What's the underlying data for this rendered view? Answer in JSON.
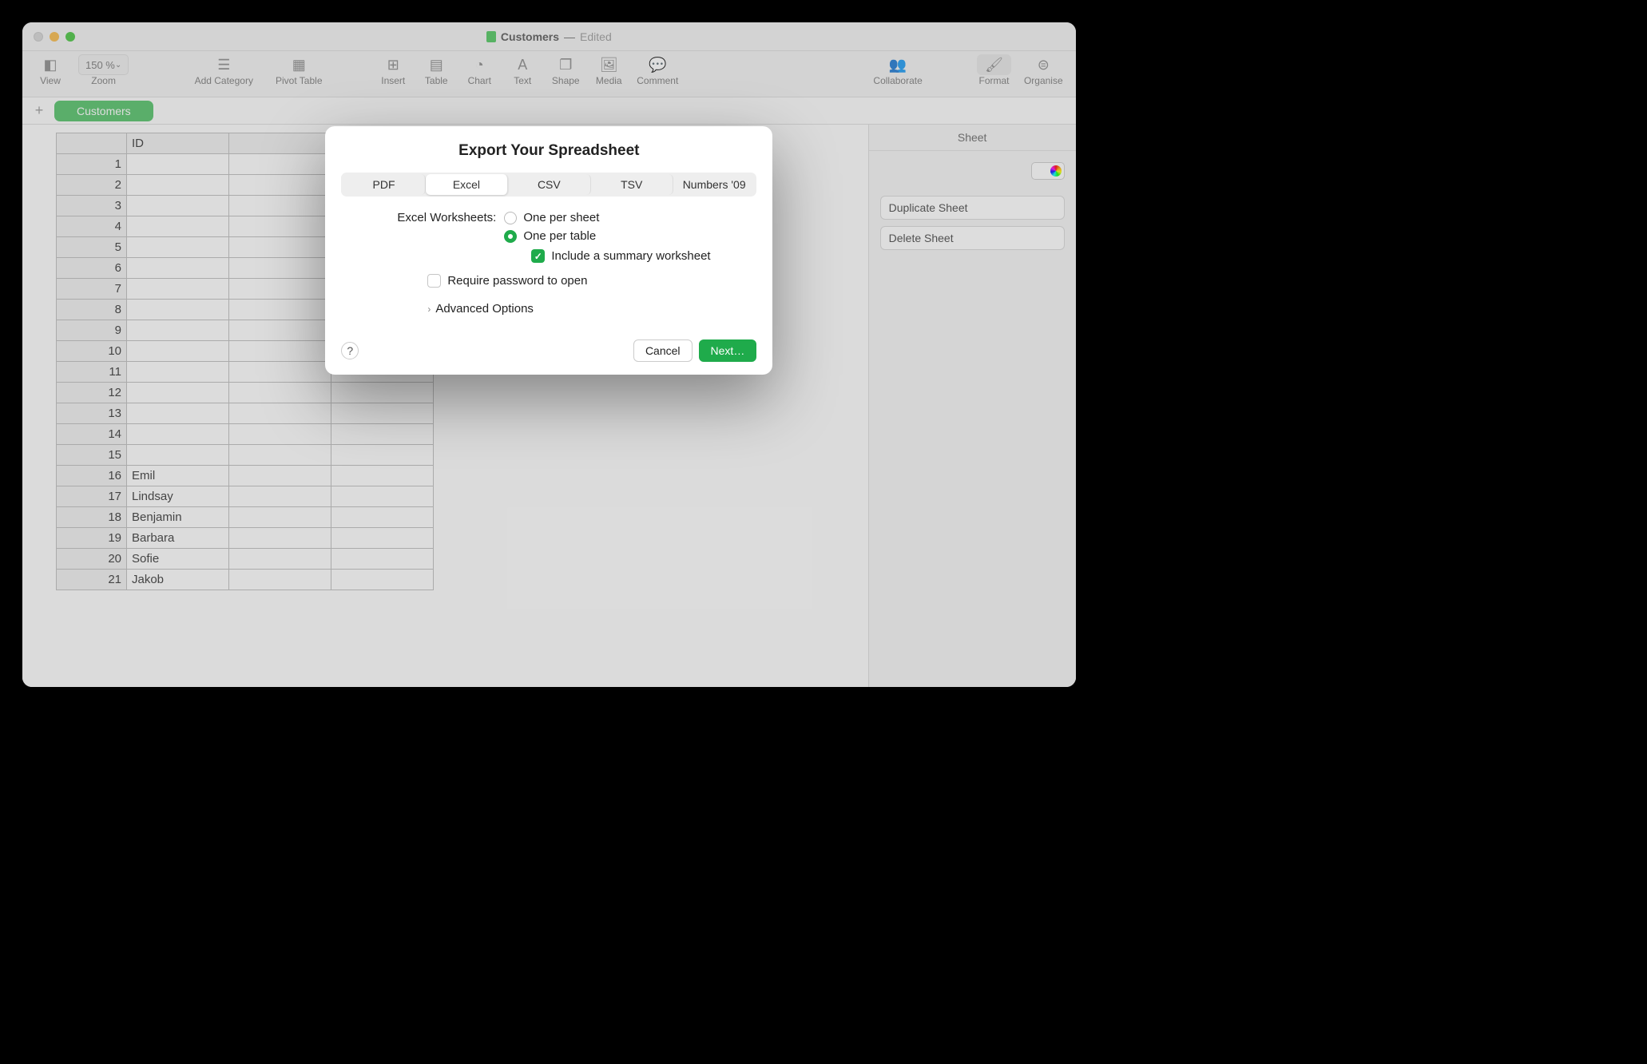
{
  "titlebar": {
    "doc_name": "Customers",
    "status": "Edited"
  },
  "toolbar": {
    "view": "View",
    "zoom_value": "150 %",
    "zoom": "Zoom",
    "add_category": "Add Category",
    "pivot_table": "Pivot Table",
    "insert": "Insert",
    "table": "Table",
    "chart": "Chart",
    "text": "Text",
    "shape": "Shape",
    "media": "Media",
    "comment": "Comment",
    "collaborate": "Collaborate",
    "format": "Format",
    "organise": "Organise"
  },
  "sheet_tab": {
    "name": "Customers"
  },
  "inspector": {
    "header": "Sheet",
    "duplicate": "Duplicate Sheet",
    "delete": "Delete Sheet"
  },
  "table": {
    "header": "ID",
    "rows": [
      {
        "n": "1",
        "name": ""
      },
      {
        "n": "2",
        "name": ""
      },
      {
        "n": "3",
        "name": ""
      },
      {
        "n": "4",
        "name": ""
      },
      {
        "n": "5",
        "name": ""
      },
      {
        "n": "6",
        "name": ""
      },
      {
        "n": "7",
        "name": ""
      },
      {
        "n": "8",
        "name": ""
      },
      {
        "n": "9",
        "name": ""
      },
      {
        "n": "10",
        "name": ""
      },
      {
        "n": "11",
        "name": ""
      },
      {
        "n": "12",
        "name": ""
      },
      {
        "n": "13",
        "name": ""
      },
      {
        "n": "14",
        "name": ""
      },
      {
        "n": "15",
        "name": ""
      },
      {
        "n": "16",
        "name": "Emil"
      },
      {
        "n": "17",
        "name": "Lindsay"
      },
      {
        "n": "18",
        "name": "Benjamin"
      },
      {
        "n": "19",
        "name": "Barbara"
      },
      {
        "n": "20",
        "name": "Sofie"
      },
      {
        "n": "21",
        "name": "Jakob"
      }
    ]
  },
  "modal": {
    "title": "Export Your Spreadsheet",
    "tabs": {
      "pdf": "PDF",
      "excel": "Excel",
      "csv": "CSV",
      "tsv": "TSV",
      "numbers09": "Numbers '09"
    },
    "worksheets_label": "Excel Worksheets:",
    "opt_per_sheet": "One per sheet",
    "opt_per_table": "One per table",
    "include_summary": "Include a summary worksheet",
    "require_password": "Require password to open",
    "advanced": "Advanced Options",
    "cancel": "Cancel",
    "next": "Next…",
    "help": "?"
  }
}
